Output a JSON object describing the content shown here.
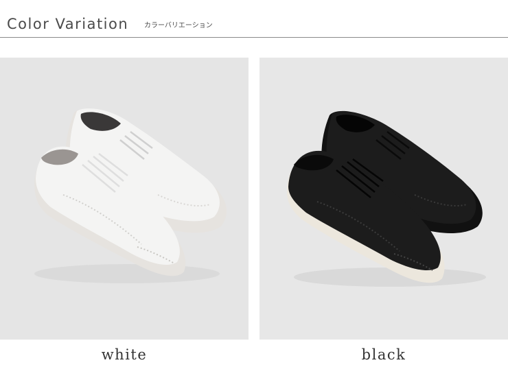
{
  "header": {
    "title": "Color Variation",
    "subtitle": "カラーバリエーション"
  },
  "variants": [
    {
      "label": "white",
      "colors": {
        "upper": "#f4f4f3",
        "shade": "#d9d8d6",
        "sole": "#e6e3df",
        "lining": "#9a9592",
        "lace": "#eeeeee",
        "background": "#e5e5e5"
      }
    },
    {
      "label": "black",
      "colors": {
        "upper": "#1c1c1c",
        "shade": "#3a3a3a",
        "sole": "#ece7dd",
        "lining": "#111111",
        "lace": "#0e0e0e",
        "background": "#e7e7e7"
      }
    }
  ]
}
